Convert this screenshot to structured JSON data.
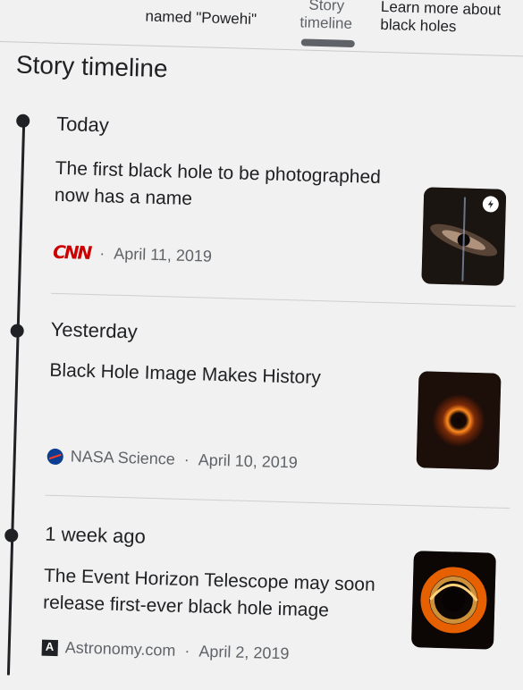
{
  "tabs": [
    {
      "label": "named \"Powehi\""
    },
    {
      "label": "Story\ntimeline",
      "selected": true
    },
    {
      "label": "Learn more about\nblack holes"
    }
  ],
  "section_title": "Story timeline",
  "timeline": [
    {
      "time": "Today",
      "headline": "The first black hole to be photographed now has a name",
      "source": "CNN",
      "date": "April 11, 2019",
      "has_amp": true
    },
    {
      "time": "Yesterday",
      "headline": "Black Hole Image Makes History",
      "source": "NASA Science",
      "date": "April 10, 2019"
    },
    {
      "time": "1 week ago",
      "headline": "The Event Horizon Telescope may soon release first-ever black hole image",
      "source": "Astronomy.com",
      "date": "April 2, 2019"
    }
  ],
  "colors": {
    "cnn_red": "#cc0000",
    "text": "#202124",
    "meta": "#5f6368",
    "background": "#f1f1f1"
  }
}
